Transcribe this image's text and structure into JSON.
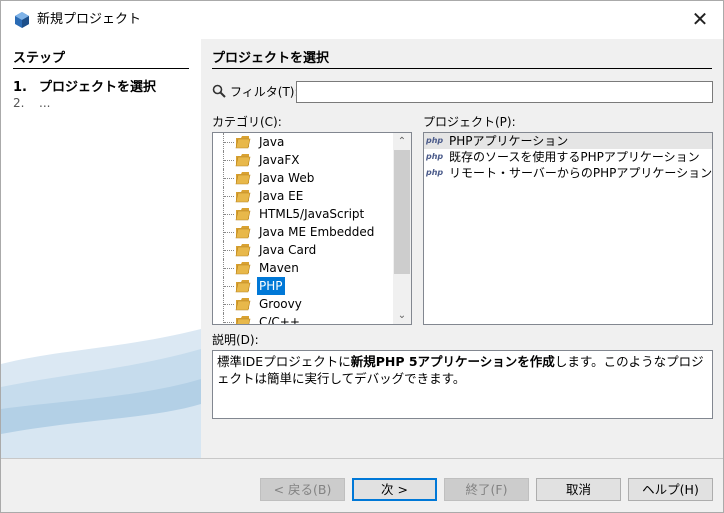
{
  "window": {
    "title": "新規プロジェクト",
    "close_glyph": "✕"
  },
  "steps": {
    "title": "ステップ",
    "items": [
      {
        "num": "1.",
        "label": "プロジェクトを選択"
      },
      {
        "num": "2.",
        "label": "..."
      }
    ]
  },
  "main": {
    "section_title": "プロジェクトを選択",
    "filter_label": "フィルタ(T):",
    "filter_value": "",
    "category_label": "カテゴリ(C):",
    "project_label": "プロジェクト(P):",
    "categories": [
      "Java",
      "JavaFX",
      "Java Web",
      "Java EE",
      "HTML5/JavaScript",
      "Java ME Embedded",
      "Java Card",
      "Maven",
      "PHP",
      "Groovy",
      "C/C++"
    ],
    "selected_category": "PHP",
    "projects": [
      {
        "icon_text": "php",
        "label": "PHPアプリケーション"
      },
      {
        "icon_text": "php",
        "label": "既存のソースを使用するPHPアプリケーション"
      },
      {
        "icon_text": "php",
        "label": "リモート・サーバーからのPHPアプリケーション"
      }
    ],
    "description_label": "説明(D):",
    "description": {
      "part1": "標準IDEプロジェクトに",
      "bold": "新規PHP 5アプリケーションを作成",
      "part2": "します。このようなプロジェクトは簡単に実行してデバッグできます。"
    }
  },
  "buttons": {
    "back": "< 戻る(B)",
    "next": "次 >",
    "finish": "終了(F)",
    "cancel": "取消",
    "help": "ヘルプ(H)"
  },
  "colors": {
    "selection": "#0078d7",
    "folder": "#e8b84a"
  },
  "icons": {
    "app": "netbeans-cube-icon",
    "search": "magnifier-icon",
    "folder": "folder-icon",
    "php": "php-file-icon",
    "scroll_up": "chevron-up-icon",
    "scroll_down": "chevron-down-icon"
  }
}
